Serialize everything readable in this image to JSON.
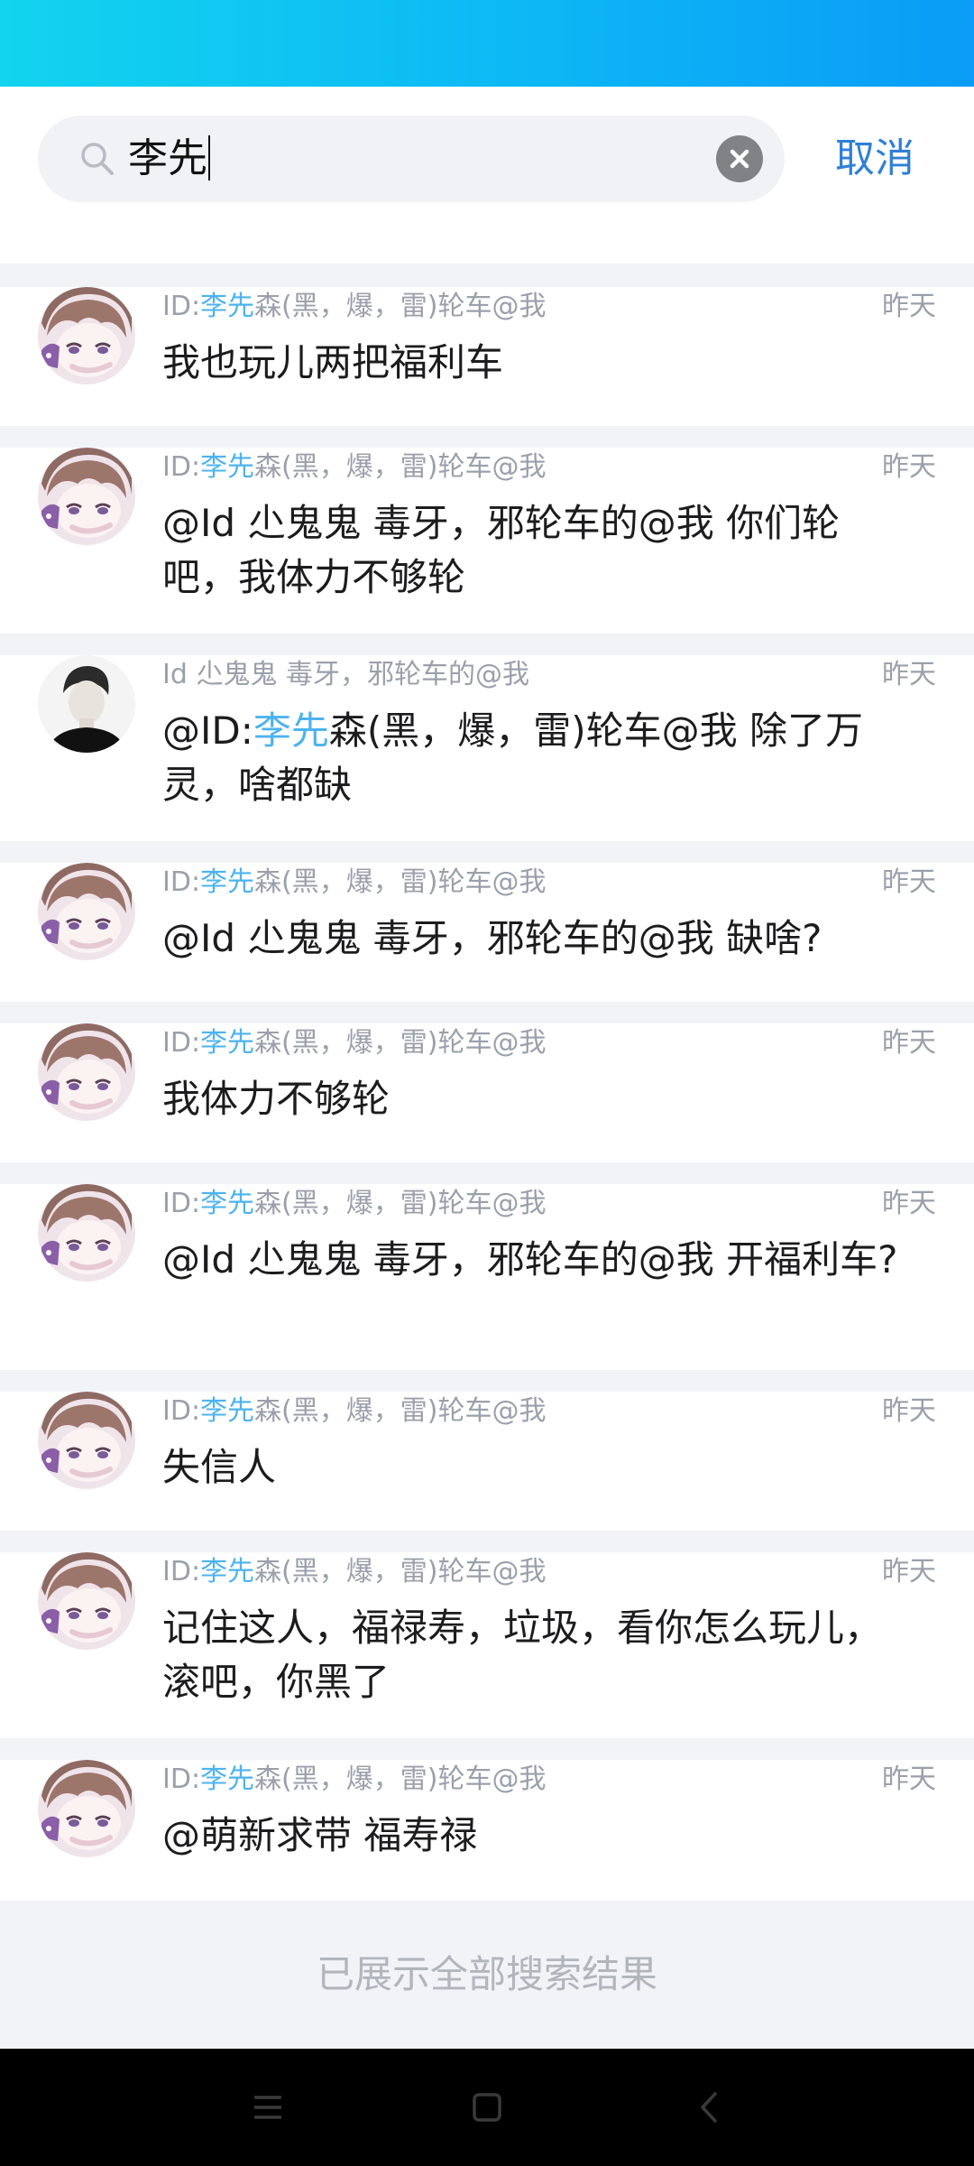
{
  "search": {
    "query": "李先",
    "cancel_label": "取消"
  },
  "results": [
    {
      "sender_prefix": "ID:",
      "sender_highlight": "李先",
      "sender_suffix": "森(黑，爆，雷)轮车@我",
      "time": "昨天",
      "message": "我也玩儿两把福利车",
      "avatar": "anime-avatar"
    },
    {
      "sender_prefix": "ID:",
      "sender_highlight": "李先",
      "sender_suffix": "森(黑，爆，雷)轮车@我",
      "time": "昨天",
      "message": "@Id 尐鬼鬼  毒牙，邪轮车的@我 你们轮吧，我体力不够轮",
      "avatar": "anime-avatar"
    },
    {
      "sender_prefix": "Id 尐鬼鬼  毒牙，邪轮车的@我",
      "sender_highlight": "",
      "sender_suffix": "",
      "time": "昨天",
      "message_prefix": "@ID:",
      "message_highlight": "李先",
      "message": "森(黑，爆，雷)轮车@我 除了万灵，啥都缺",
      "avatar": "man-avatar"
    },
    {
      "sender_prefix": "ID:",
      "sender_highlight": "李先",
      "sender_suffix": "森(黑，爆，雷)轮车@我",
      "time": "昨天",
      "message": "@Id 尐鬼鬼  毒牙，邪轮车的@我 缺啥?",
      "avatar": "anime-avatar"
    },
    {
      "sender_prefix": "ID:",
      "sender_highlight": "李先",
      "sender_suffix": "森(黑，爆，雷)轮车@我",
      "time": "昨天",
      "message": "我体力不够轮",
      "avatar": "anime-avatar"
    },
    {
      "sender_prefix": "ID:",
      "sender_highlight": "李先",
      "sender_suffix": "森(黑，爆，雷)轮车@我",
      "time": "昨天",
      "message": "@Id 尐鬼鬼  毒牙，邪轮车的@我 开福利车?",
      "avatar": "anime-avatar"
    },
    {
      "sender_prefix": "ID:",
      "sender_highlight": "李先",
      "sender_suffix": "森(黑，爆，雷)轮车@我",
      "time": "昨天",
      "message": "失信人",
      "avatar": "anime-avatar"
    },
    {
      "sender_prefix": "ID:",
      "sender_highlight": "李先",
      "sender_suffix": "森(黑，爆，雷)轮车@我",
      "time": "昨天",
      "message": "记住这人，福禄寿，垃圾，看你怎么玩儿，滚吧，你黑了",
      "avatar": "anime-avatar"
    },
    {
      "sender_prefix": "ID:",
      "sender_highlight": "李先",
      "sender_suffix": "森(黑，爆，雷)轮车@我",
      "time": "昨天",
      "message": "@萌新求带 福寿禄",
      "avatar": "anime-avatar"
    }
  ],
  "footer_text": "已展示全部搜索结果",
  "colors": {
    "accent": "#2f7fd6",
    "highlight": "#4db3ee",
    "header_gradient_start": "#12d4ee",
    "header_gradient_end": "#0a9cf6"
  }
}
